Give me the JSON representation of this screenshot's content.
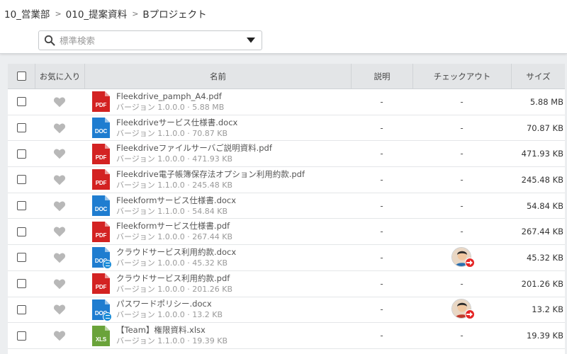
{
  "breadcrumb": [
    {
      "label": "10_営業部"
    },
    {
      "label": "010_提案資料"
    },
    {
      "label": "Bプロジェクト"
    }
  ],
  "breadcrumb_separator": ">",
  "search": {
    "placeholder": "標準検索",
    "value": ""
  },
  "table": {
    "headers": {
      "favorite": "お気に入り",
      "name": "名前",
      "description": "説明",
      "checkout": "チェックアウト",
      "size": "サイズ"
    },
    "rows": [
      {
        "type_label": "PDF",
        "type": "pdf",
        "name": "Fleekdrive_pamph_A4.pdf",
        "meta": "バージョン 1.0.0.0 · 5.88 MB",
        "description": "-",
        "checkout": "-",
        "size": "5.88 MB"
      },
      {
        "type_label": "DOC",
        "type": "doc",
        "name": "Fleekdriveサービス仕様書.docx",
        "meta": "バージョン 1.1.0.0 · 70.87 KB",
        "description": "-",
        "checkout": "-",
        "size": "70.87 KB"
      },
      {
        "type_label": "PDF",
        "type": "pdf",
        "name": "Fleekdriveファイルサーバご説明資料.pdf",
        "meta": "バージョン 1.0.0.0 · 471.93 KB",
        "description": "-",
        "checkout": "-",
        "size": "471.93 KB"
      },
      {
        "type_label": "PDF",
        "type": "pdf",
        "name": "Fleekdrive電子帳簿保存法オプション利用約款.pdf",
        "meta": "バージョン 1.1.0.0 · 245.48 KB",
        "description": "-",
        "checkout": "-",
        "size": "245.48 KB"
      },
      {
        "type_label": "DOC",
        "type": "doc",
        "name": "Fleekformサービス仕様書.docx",
        "meta": "バージョン 1.1.0.0 · 54.84 KB",
        "description": "-",
        "checkout": "-",
        "size": "54.84 KB"
      },
      {
        "type_label": "PDF",
        "type": "pdf",
        "name": "Fleekformサービス仕様書.pdf",
        "meta": "バージョン 1.0.0.0 · 267.44 KB",
        "description": "-",
        "checkout": "-",
        "size": "267.44 KB"
      },
      {
        "type_label": "DOC",
        "type": "doc",
        "name": "クラウドサービス利用約款.docx",
        "meta": "バージョン 1.0.0.0 · 45.32 KB",
        "description": "-",
        "checkout": "",
        "checked_out": true,
        "avatar_shirt": "#2a6fb0",
        "size": "45.32 KB"
      },
      {
        "type_label": "PDF",
        "type": "pdf",
        "name": "クラウドサービス利用約款.pdf",
        "meta": "バージョン 1.0.0.0 · 201.26 KB",
        "description": "-",
        "checkout": "-",
        "size": "201.26 KB"
      },
      {
        "type_label": "DOC",
        "type": "doc",
        "name": "パスワードポリシー.docx",
        "meta": "バージョン 1.0.0.0 · 13.2 KB",
        "description": "-",
        "checkout": "",
        "checked_out": true,
        "avatar_shirt": "#c0392b",
        "size": "13.2 KB"
      },
      {
        "type_label": "XLS",
        "type": "xls",
        "name": "【Team】権限資料.xlsx",
        "meta": "バージョン 1.1.0.0 · 19.39 KB",
        "description": "-",
        "checkout": "-",
        "size": "19.39 KB"
      }
    ]
  },
  "colors": {
    "pdf": "#d32222",
    "doc": "#1f7dd0",
    "xls": "#6aa33a",
    "heart": "#b8b8b8",
    "header_bg": "#e3e5e7",
    "checkout_badge": "#e52626"
  },
  "icons": {
    "search": "search-icon",
    "dropdown": "caret-down-icon",
    "favorite": "heart-icon",
    "checkout": "checkout-arrow-icon",
    "version": "version-badge-icon"
  }
}
